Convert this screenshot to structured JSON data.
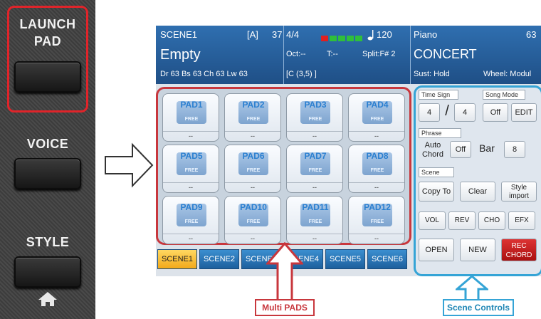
{
  "hardware": {
    "launch_pad_line1": "LAUNCH",
    "launch_pad_line2": "PAD",
    "voice_label": "VOICE",
    "style_label": "STYLE",
    "home_icon": "home-icon"
  },
  "arrow_icon": "right-arrow-outline-icon",
  "screen": {
    "header": {
      "scene_name": "SCENE1",
      "bank": "[A]",
      "scene_number": "37",
      "title": "Empty",
      "parts": "Dr 63  Bs 63  Ch 63  Lw 63",
      "time_sig": "4/4",
      "tempo": "120",
      "oct": "Oct:--",
      "transpose": "T:--",
      "split": "Split:F# 2",
      "chord": "[C        (3,5) ]",
      "voice_name": "Piano",
      "voice_number": "63",
      "voice_style": "CONCERT",
      "sustain": "Sust: Hold",
      "wheel": "Wheel: Modul",
      "level_colors": [
        "#e02020",
        "#2fbf3a",
        "#2fbf3a",
        "#2fbf3a",
        "#2fbf3a"
      ],
      "note_icon": "quarter-note-icon"
    },
    "pads": [
      {
        "name": "PAD1",
        "badge": "FREE",
        "value": "--"
      },
      {
        "name": "PAD2",
        "badge": "FREE",
        "value": "--"
      },
      {
        "name": "PAD3",
        "badge": "FREE",
        "value": "--"
      },
      {
        "name": "PAD4",
        "badge": "FREE",
        "value": "--"
      },
      {
        "name": "PAD5",
        "badge": "FREE",
        "value": "--"
      },
      {
        "name": "PAD6",
        "badge": "FREE",
        "value": "--"
      },
      {
        "name": "PAD7",
        "badge": "FREE",
        "value": "--"
      },
      {
        "name": "PAD8",
        "badge": "FREE",
        "value": "--"
      },
      {
        "name": "PAD9",
        "badge": "FREE",
        "value": "--"
      },
      {
        "name": "PAD10",
        "badge": "FREE",
        "value": "--"
      },
      {
        "name": "PAD11",
        "badge": "FREE",
        "value": "--"
      },
      {
        "name": "PAD12",
        "badge": "FREE",
        "value": "--"
      }
    ],
    "scenes": [
      "SCENE1",
      "SCENE2",
      "SCENE3",
      "SCENE4",
      "SCENE5",
      "SCENE6"
    ],
    "active_scene": "SCENE1",
    "controls": {
      "time_sign_label": "Time Sign",
      "time_sign_num": "4",
      "time_sign_slash": "/",
      "time_sign_den": "4",
      "song_mode_label": "Song Mode",
      "song_mode_value": "Off",
      "edit_label": "EDIT",
      "phrase_label": "Phrase",
      "auto_chord_line1": "Auto",
      "auto_chord_line2": "Chord",
      "auto_chord_value": "Off",
      "bar_label": "Bar",
      "bar_value": "8",
      "scene_label": "Scene",
      "copy_to": "Copy To",
      "clear": "Clear",
      "style_import_line1": "Style",
      "style_import_line2": "import",
      "vol": "VOL",
      "rev": "REV",
      "cho": "CHO",
      "efx": "EFX",
      "open": "OPEN",
      "new": "NEW",
      "rec_chord_line1": "REC",
      "rec_chord_line2": "CHORD"
    }
  },
  "annotations": {
    "multi_pads": "Multi PADS",
    "scene_controls": "Scene Controls",
    "pads_color": "#c8373d",
    "controls_color": "#35a4d6"
  }
}
